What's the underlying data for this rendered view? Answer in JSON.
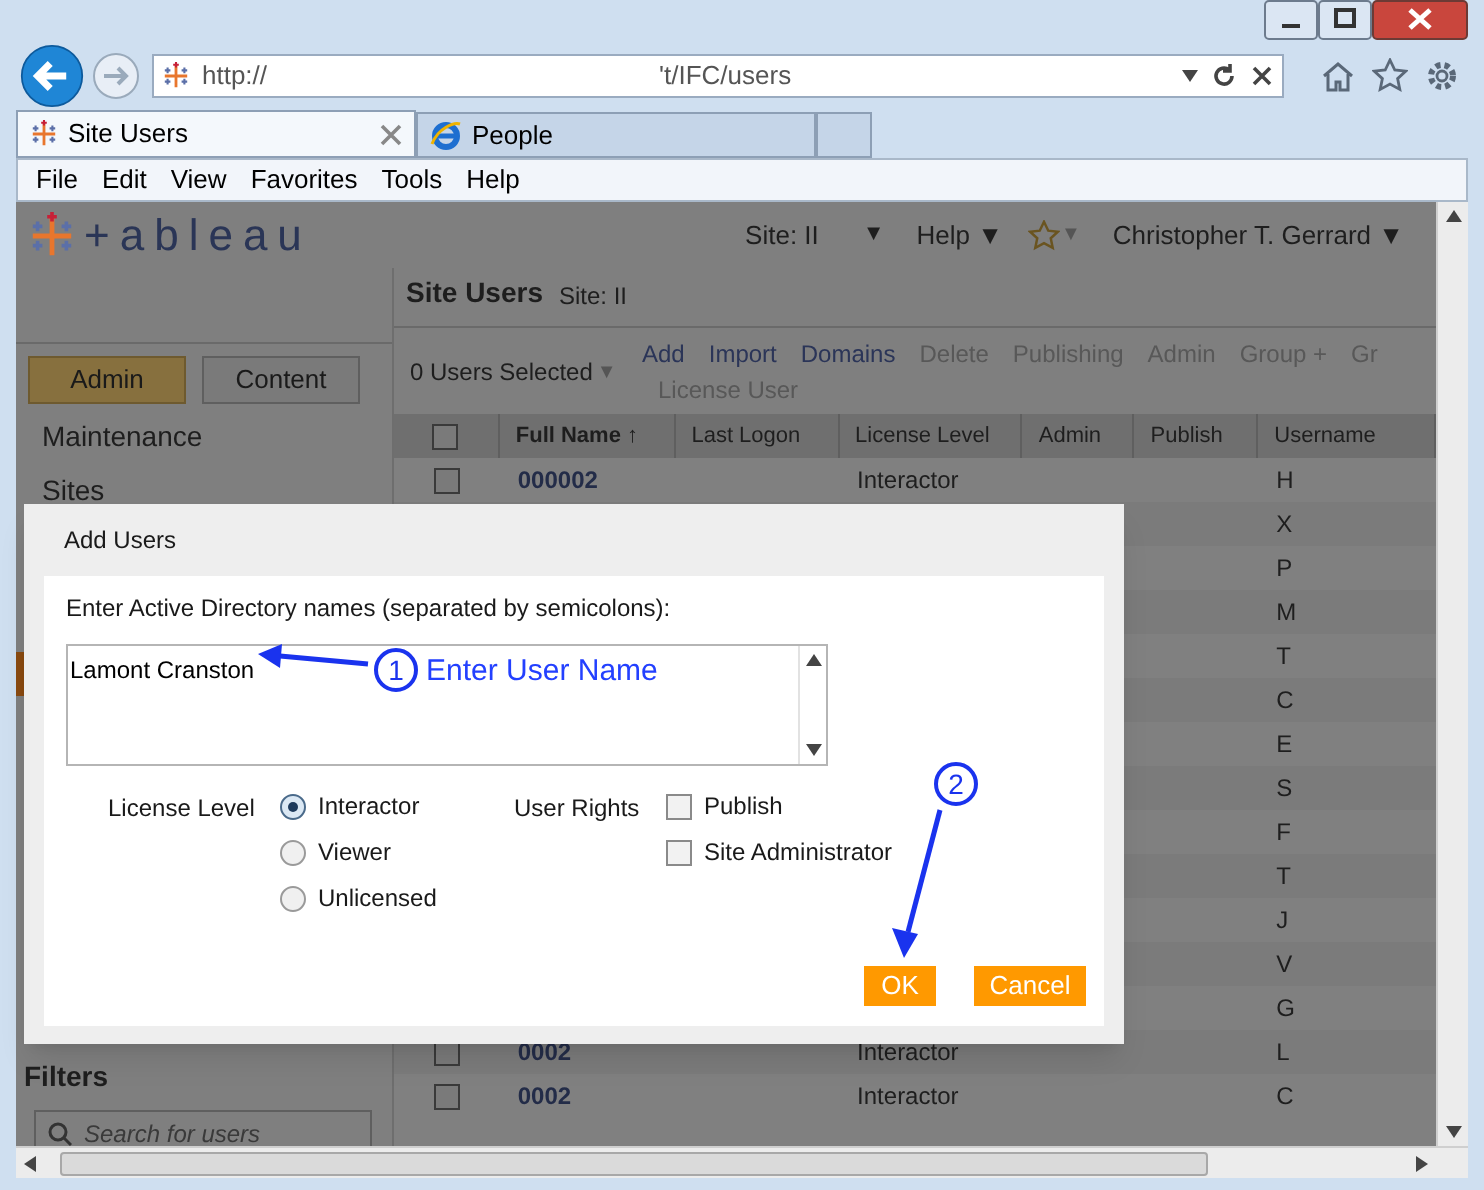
{
  "browser": {
    "address_start": "http://",
    "address_end": "'t/IFC/users",
    "tabs": [
      {
        "label": "Site Users",
        "selected": true,
        "kind": "tableau"
      },
      {
        "label": "People",
        "selected": false,
        "kind": "ie"
      }
    ],
    "menu": [
      "File",
      "Edit",
      "View",
      "Favorites",
      "Tools",
      "Help"
    ]
  },
  "header": {
    "logo_text": "+ableau",
    "site": "Site: II",
    "site_caret": "▼",
    "help": "Help ▼",
    "star_caret": "▼",
    "user": "Christopher T. Gerrard ▼"
  },
  "sidebar": {
    "buttons": [
      {
        "label": "Admin",
        "selected": true
      },
      {
        "label": "Content",
        "selected": false
      }
    ],
    "items": [
      "Maintenance",
      "Sites"
    ],
    "filters_title": "Filters",
    "search_placeholder": "Search for users"
  },
  "main": {
    "title": "Site Users",
    "site": "Site: II",
    "selection": "0 Users Selected",
    "selection_caret": "▼",
    "actions": [
      {
        "label": "Add",
        "disabled": false
      },
      {
        "label": "Import",
        "disabled": false
      },
      {
        "label": "Domains",
        "disabled": false
      },
      {
        "label": "Delete",
        "disabled": true
      },
      {
        "label": "Publishing",
        "disabled": true
      },
      {
        "label": "Admin",
        "disabled": true
      },
      {
        "label": "Group +",
        "disabled": true
      },
      {
        "label": "Gr",
        "disabled": true
      }
    ],
    "actions_row2": [
      {
        "label": "License User",
        "disabled": true
      }
    ],
    "columns": [
      "Full Name ↑",
      "Last Logon",
      "License Level",
      "Admin",
      "Publish",
      "Username"
    ],
    "rows": [
      {
        "full_name": "000002",
        "license": "Interactor",
        "username": "H",
        "checked": false
      },
      {
        "username": "X"
      },
      {
        "username": "P"
      },
      {
        "username": "M"
      },
      {
        "username": "T"
      },
      {
        "username": "C"
      },
      {
        "username": "E"
      },
      {
        "username": "S"
      },
      {
        "username": "F"
      },
      {
        "username": "T"
      },
      {
        "username": "J"
      },
      {
        "username": "V"
      },
      {
        "username": "G"
      },
      {
        "full_name": "0002",
        "license": "Interactor",
        "username": "L",
        "checked": false
      },
      {
        "full_name": "0002",
        "license": "Interactor",
        "username": "C",
        "checked": false
      }
    ],
    "all_checked": false
  },
  "dialog": {
    "title": "Add Users",
    "prompt": "Enter Active Directory names (separated by semicolons):",
    "names": "Lamont Cranston",
    "license_label": "License Level",
    "license_options": [
      {
        "label": "Interactor",
        "selected": true
      },
      {
        "label": "Viewer",
        "selected": false
      },
      {
        "label": "Unlicensed",
        "selected": false
      }
    ],
    "rights_label": "User Rights",
    "rights": [
      {
        "label": "Publish",
        "checked": false
      },
      {
        "label": "Site Administrator",
        "checked": false
      }
    ],
    "buttons": [
      "OK",
      "Cancel"
    ]
  },
  "callouts": [
    {
      "number": "1",
      "text": "Enter User Name"
    },
    {
      "number": "2"
    }
  ]
}
